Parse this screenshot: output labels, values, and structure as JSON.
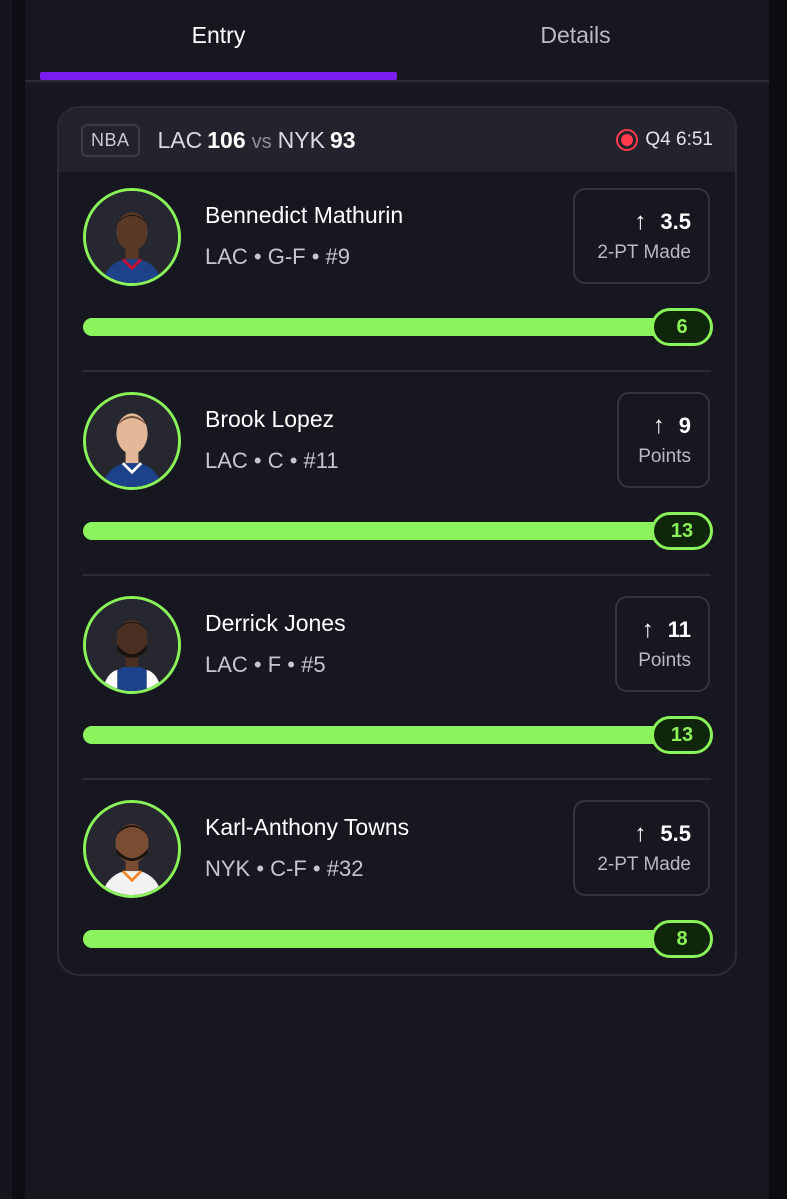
{
  "tabs": [
    {
      "label": "Entry",
      "active": true
    },
    {
      "label": "Details",
      "active": false
    }
  ],
  "game": {
    "league": "NBA",
    "home_team": "LAC",
    "home_score": "106",
    "vs": "vs",
    "away_team": "NYK",
    "away_score": "93",
    "clock": "Q4 6:51",
    "live_icon": "live-record-icon",
    "live_color": "#ff3b4a"
  },
  "accent": "#8bf35a",
  "tab_accent": "#7b1cf0",
  "players": [
    {
      "name": "Bennedict Mathurin",
      "meta": "LAC • G-F • #9",
      "line": "3.5",
      "stat": "2-PT Made",
      "direction_icon": "arrow-up-icon",
      "current": "6",
      "progress_fraction": 1.0,
      "jersey_color": "#1d428a"
    },
    {
      "name": "Brook Lopez",
      "meta": "LAC • C • #11",
      "line": "9",
      "stat": "Points",
      "direction_icon": "arrow-up-icon",
      "current": "13",
      "progress_fraction": 1.0,
      "jersey_color": "#1d428a"
    },
    {
      "name": "Derrick Jones",
      "meta": "LAC • F • #5",
      "line": "11",
      "stat": "Points",
      "direction_icon": "arrow-up-icon",
      "current": "13",
      "progress_fraction": 1.0,
      "jersey_color": "#1d428a"
    },
    {
      "name": "Karl-Anthony Towns",
      "meta": "NYK • C-F • #32",
      "line": "5.5",
      "stat": "2-PT Made",
      "direction_icon": "arrow-up-icon",
      "current": "8",
      "progress_fraction": 1.0,
      "jersey_color": "#f2f2f2"
    }
  ]
}
